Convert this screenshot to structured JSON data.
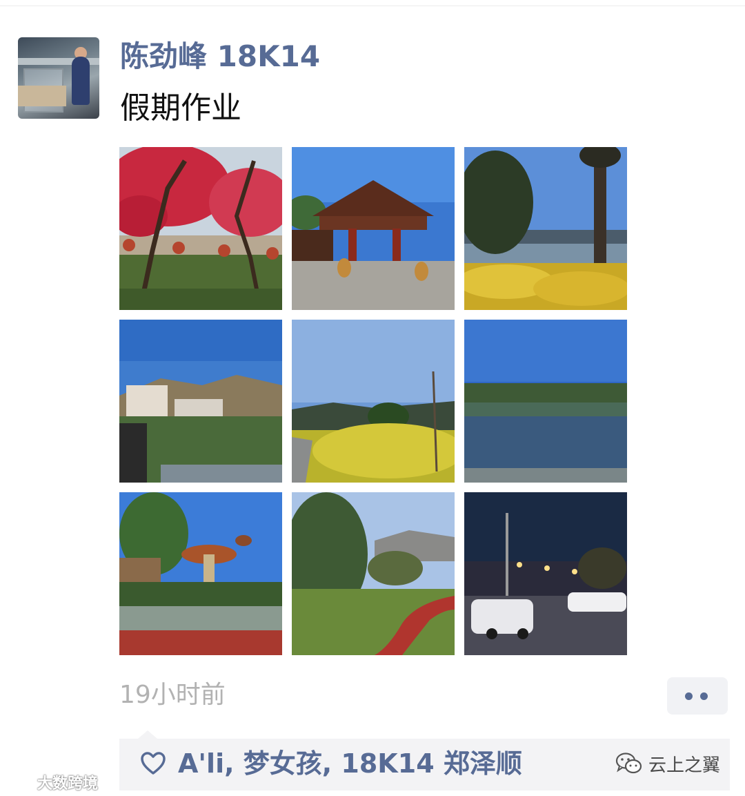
{
  "post": {
    "username": "陈劲峰 18K14",
    "text": "假期作业",
    "timestamp": "19小时前",
    "photos": [
      {
        "name": "plum-blossom-trees"
      },
      {
        "name": "wooden-pavilion-gate"
      },
      {
        "name": "lake-with-yellow-flowers"
      },
      {
        "name": "town-and-mountains"
      },
      {
        "name": "rapeseed-field-road"
      },
      {
        "name": "calm-lake"
      },
      {
        "name": "mushroom-sculpture-park"
      },
      {
        "name": "garden-red-path"
      },
      {
        "name": "night-street-cars"
      }
    ]
  },
  "likes": {
    "names": "A'li, 梦女孩, 18K14 郑泽顺"
  },
  "watermarks": {
    "right": "云上之翼",
    "left": "大数跨境"
  },
  "colors": {
    "link": "#576b95",
    "timestamp": "#b2b2b2",
    "panel": "#f3f3f5"
  },
  "icons": {
    "like": "heart-outline-icon",
    "more": "two-dots-icon",
    "wechat": "wechat-logo-icon"
  }
}
